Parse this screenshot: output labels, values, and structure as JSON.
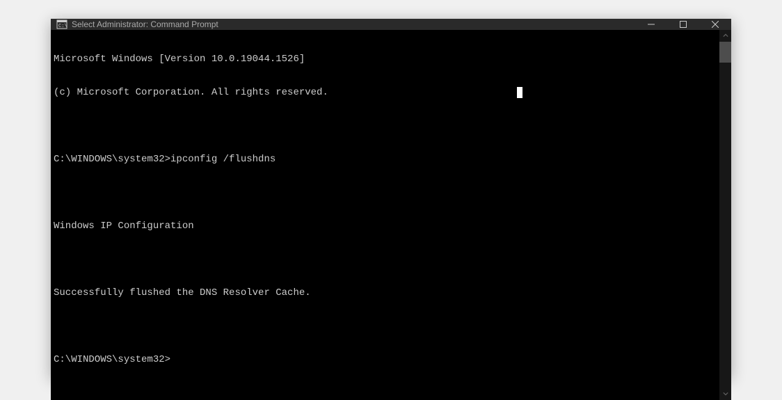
{
  "titlebar": {
    "title": "Select Administrator: Command Prompt"
  },
  "terminal": {
    "lines": [
      "Microsoft Windows [Version 10.0.19044.1526]",
      "(c) Microsoft Corporation. All rights reserved.",
      "",
      "C:\\WINDOWS\\system32>ipconfig /flushdns",
      "",
      "Windows IP Configuration",
      "",
      "Successfully flushed the DNS Resolver Cache.",
      "",
      "C:\\WINDOWS\\system32>"
    ]
  }
}
